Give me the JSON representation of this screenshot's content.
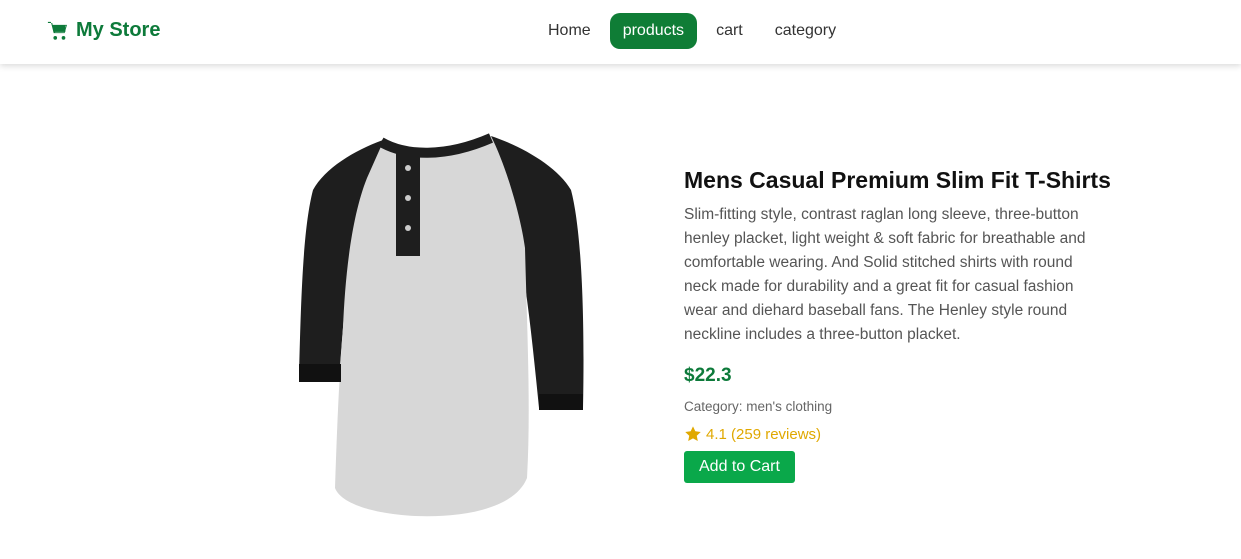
{
  "nav": {
    "brand": "My Store",
    "brand_icon": "shopping-cart-icon",
    "links": [
      "Home",
      "products",
      "cart",
      "category"
    ],
    "active": "products"
  },
  "product": {
    "title": "Mens Casual Premium Slim Fit T-Shirts",
    "description": "Slim-fitting style, contrast raglan long sleeve, three-button henley placket, light weight & soft fabric for breathable and comfortable wearing. And Solid stitched shirts with round neck made for durability and a great fit for casual fashion wear and diehard baseball fans. The Henley style round neckline includes a three-button placket.",
    "price": "$22.3",
    "category": "Category: men's clothing",
    "rating_text": "4.1 (259 reviews)",
    "rating_icon": "star-icon",
    "add_to_cart": "Add to Cart"
  },
  "colors": {
    "brand_green": "#0d7a3a",
    "button_green": "#0aa84a",
    "star": "#e0a800"
  }
}
